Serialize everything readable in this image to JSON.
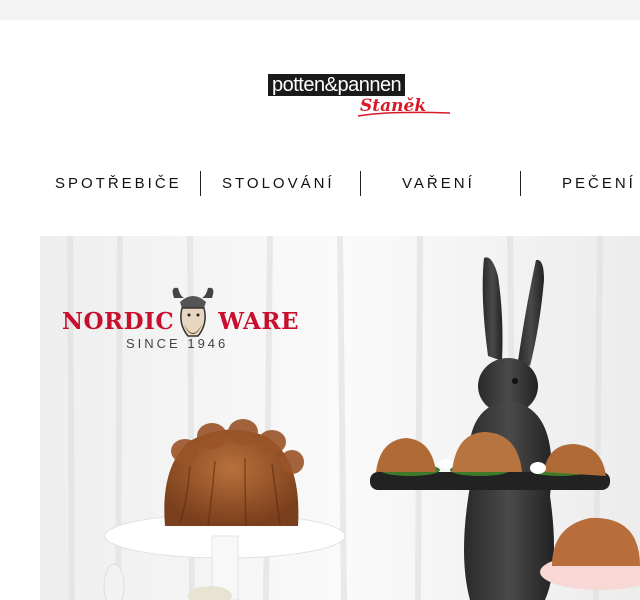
{
  "logo": {
    "boxed_text": "potten&pannen",
    "script_text": "Staněk"
  },
  "nav": {
    "items": [
      {
        "label": "SPOTŘEBIČE"
      },
      {
        "label": "STOLOVÁNÍ"
      },
      {
        "label": "VAŘENÍ"
      },
      {
        "label": "PEČENÍ"
      }
    ]
  },
  "hero": {
    "brand_left": "NORDIC",
    "brand_right": "WARE",
    "brand_since": "SINCE 1946",
    "colors": {
      "brand_red": "#c8102e",
      "logo_red": "#d8192a"
    }
  }
}
